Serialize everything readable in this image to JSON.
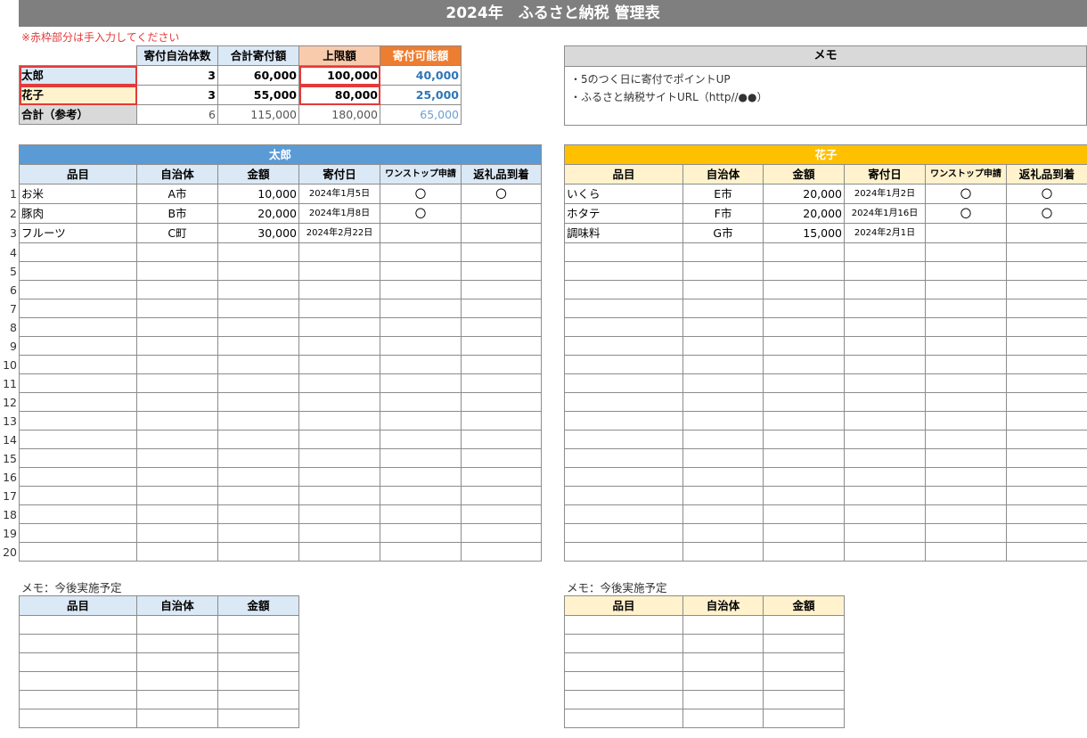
{
  "title": "2024年　ふるさと納税 管理表",
  "note": "※赤枠部分は手入力してください",
  "summary": {
    "headers": [
      "寄付自治体数",
      "合計寄付額",
      "上限額",
      "寄付可能額"
    ],
    "rows": [
      {
        "name": "太郎",
        "count": "3",
        "total": "60,000",
        "limit": "100,000",
        "available": "40,000"
      },
      {
        "name": "花子",
        "count": "3",
        "total": "55,000",
        "limit": "80,000",
        "available": "25,000"
      },
      {
        "name": "合計（参考）",
        "count": "6",
        "total": "115,000",
        "limit": "180,000",
        "available": "65,000"
      }
    ]
  },
  "memo": {
    "title": "メモ",
    "lines": [
      "・5のつく日に寄付でポイントUP",
      "・ふるさと納税サイトURL（http//●●）"
    ]
  },
  "columns": [
    "品目",
    "自治体",
    "金額",
    "寄付日",
    "ワンストップ申請",
    "返礼品到着"
  ],
  "taro": {
    "title": "太郎",
    "rows": [
      {
        "item": "お米",
        "city": "A市",
        "amount": "10,000",
        "date": "2024年1月5日",
        "onestop": "〇",
        "arrived": "〇"
      },
      {
        "item": "豚肉",
        "city": "B市",
        "amount": "20,000",
        "date": "2024年1月8日",
        "onestop": "〇",
        "arrived": ""
      },
      {
        "item": "フルーツ",
        "city": "C町",
        "amount": "30,000",
        "date": "2024年2月22日",
        "onestop": "",
        "arrived": ""
      }
    ]
  },
  "hanako": {
    "title": "花子",
    "rows": [
      {
        "item": "いくら",
        "city": "E市",
        "amount": "20,000",
        "date": "2024年1月2日",
        "onestop": "〇",
        "arrived": "〇"
      },
      {
        "item": "ホタテ",
        "city": "F市",
        "amount": "20,000",
        "date": "2024年1月16日",
        "onestop": "〇",
        "arrived": "〇"
      },
      {
        "item": "調味料",
        "city": "G市",
        "amount": "15,000",
        "date": "2024年2月1日",
        "onestop": "",
        "arrived": ""
      }
    ]
  },
  "row_numbers": [
    "1",
    "2",
    "3",
    "4",
    "5",
    "6",
    "7",
    "8",
    "9",
    "10",
    "11",
    "12",
    "13",
    "14",
    "15",
    "16",
    "17",
    "18",
    "19",
    "20"
  ],
  "plan": {
    "label": "メモ：今後実施予定",
    "columns": [
      "品目",
      "自治体",
      "金額"
    ]
  }
}
